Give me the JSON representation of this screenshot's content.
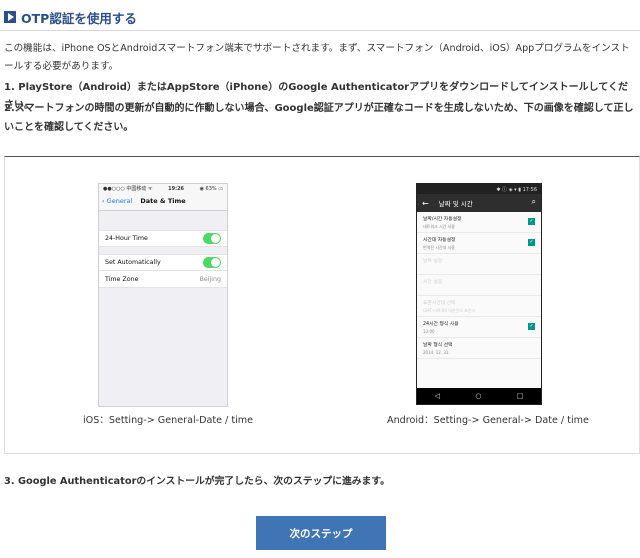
{
  "header": {
    "title": "OTP認証を使用する"
  },
  "intro": "この機能は、iPhone OSとAndroidスマートフォン端末でサポートされます。まず、スマートフォン（Android、iOS）Appプログラムをインストールする必要があります。",
  "step1": "1. PlayStore（Android）またはAppStore（iPhone）のGoogle Authenticatorアプリをダウンロードしてインストールしてください。",
  "step2": "2.スマートフォンの時間の更新が自動的に作動しない場合、Google認証アプリが正確なコードを生成しないため、下の画像を確認して正しいことを確認してください。",
  "ios_screen": {
    "status_left": "●●○○○ 中国移动 ᯤ",
    "status_time": "19:26",
    "status_right": "◉ 63% ▭",
    "back_label": "General",
    "title": "Date & Time",
    "row1_label": "24-Hour Time",
    "row2_label": "Set Automatically",
    "row3_label": "Time Zone",
    "row3_value": "Beijing"
  },
  "android_screen": {
    "status_right": "✱ ⓘ ◈ ▾ ▮ 17:56",
    "title": "날짜 및 시간",
    "rows": [
      {
        "t1": "날짜/시간 자동설정",
        "t2": "네트워크 시간 사용"
      },
      {
        "t1": "시간대 자동설정",
        "t2": "번역된 시간대 사용"
      },
      {
        "t1": "날짜 설정",
        "t2": ""
      },
      {
        "t1": "시간 설정",
        "t2": ""
      },
      {
        "t1": "표준시간대 선택",
        "t2": "GMT+09:00 대한민국 표준시"
      },
      {
        "t1": "24시간 형식 사용",
        "t2": "13:00"
      },
      {
        "t1": "날짜 형식 선택",
        "t2": "2014. 12. 31."
      }
    ]
  },
  "captions": {
    "ios": "iOS：Setting-> General-Date / time",
    "android": "Android：Setting-> General-> Date / time"
  },
  "step3": "3. Google Authenticatorのインストールが完了したら、次のステップに進みます。",
  "next_button": "次のステップ",
  "colors": {
    "title_blue": "#2b4f8a",
    "button_blue": "#3f74b5",
    "ios_toggle": "#4cd964",
    "android_check": "#009688"
  }
}
